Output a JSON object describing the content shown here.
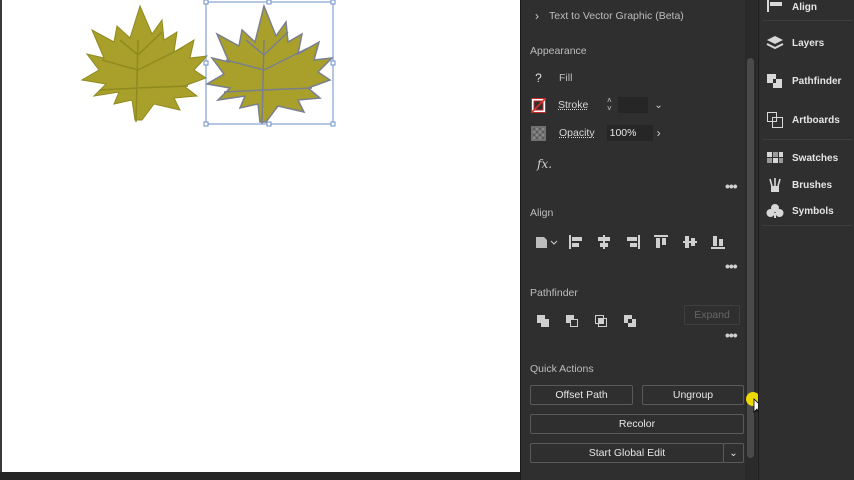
{
  "top_item": {
    "label": "Text to Vector Graphic (Beta)"
  },
  "appearance": {
    "title": "Appearance",
    "fill_label": "Fill",
    "fill_mark": "?",
    "stroke_label": "Stroke",
    "opacity_label": "Opacity",
    "opacity_value": "100%",
    "fx_label": "fx."
  },
  "align": {
    "title": "Align"
  },
  "pathfinder": {
    "title": "Pathfinder",
    "expand_label": "Expand"
  },
  "quick_actions": {
    "title": "Quick Actions",
    "offset_path": "Offset Path",
    "ungroup": "Ungroup",
    "recolor": "Recolor",
    "start_global_edit": "Start Global Edit"
  },
  "dock": {
    "align": "Align",
    "layers": "Layers",
    "pathfinder": "Pathfinder",
    "artboards": "Artboards",
    "swatches": "Swatches",
    "brushes": "Brushes",
    "symbols": "Symbols"
  },
  "colors": {
    "leaf_fill": "#a8a02a",
    "leaf_vein": "#7a7f8e",
    "selection": "#6b8fc9",
    "cursor_highlight": "#f5e000"
  }
}
